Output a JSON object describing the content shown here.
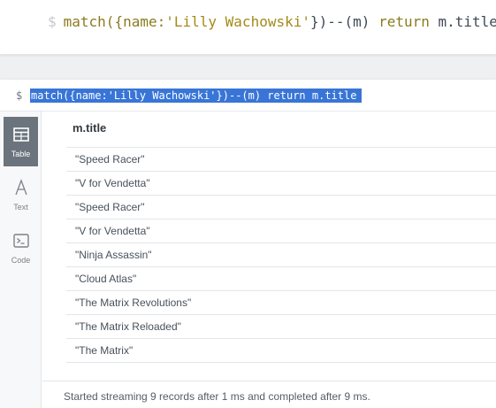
{
  "editor": {
    "prompt": "$",
    "query_parts": [
      "match({name:",
      "'Lilly Wachowski'",
      "})--(m) ",
      "return",
      " m.title"
    ]
  },
  "result": {
    "prompt": "$",
    "query": "match({name:'Lilly Wachowski'})--(m) return m.title",
    "views": [
      {
        "label": "Table",
        "icon": "table-icon",
        "active": true
      },
      {
        "label": "Text",
        "icon": "text-icon",
        "active": false
      },
      {
        "label": "Code",
        "icon": "code-icon",
        "active": false
      }
    ],
    "column": "m.title",
    "rows": [
      "\"Speed Racer\"",
      "\"V for Vendetta\"",
      "\"Speed Racer\"",
      "\"V for Vendetta\"",
      "\"Ninja Assassin\"",
      "\"Cloud Atlas\"",
      "\"The Matrix Revolutions\"",
      "\"The Matrix Reloaded\"",
      "\"The Matrix\""
    ],
    "status": "Started streaming 9 records after 1 ms and completed after 9 ms."
  }
}
